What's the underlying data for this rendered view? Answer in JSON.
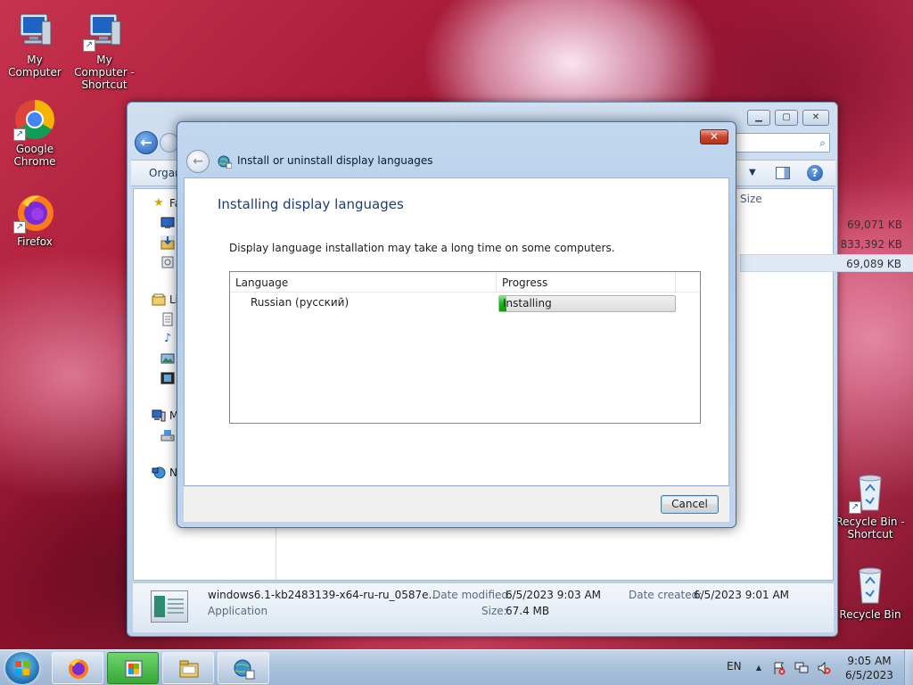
{
  "desktop": {
    "icons": [
      {
        "label": "My Computer"
      },
      {
        "label": "My Computer - Shortcut"
      },
      {
        "label": "Google Chrome"
      },
      {
        "label": "Firefox"
      },
      {
        "label": "Recycle Bin - Shortcut"
      },
      {
        "label": "Recycle Bin"
      }
    ],
    "shortcut_arrow": "↗"
  },
  "explorer": {
    "organize_label": "Organ",
    "search_icon": "⌕",
    "minimize_glyph": "▁",
    "maximize_glyph": "▢",
    "close_glyph": "✕",
    "back_glyph": "←",
    "view_dropdown_glyph": "▼",
    "help_glyph": "?",
    "nav_pane": {
      "favorites_label": "Fa",
      "libraries_label": "Li",
      "computer_label": "M",
      "network_label": "N"
    },
    "size_column_label": "Size",
    "sizes": [
      "69,071 KB",
      "833,392 KB",
      "69,089 KB"
    ],
    "details": {
      "file_name": "windows6.1-kb2483139-x64-ru-ru_0587e...",
      "file_type": "Application",
      "date_modified_label": "Date modified:",
      "date_modified_value": "6/5/2023 9:03 AM",
      "size_label": "Size:",
      "size_value": "67.4 MB",
      "date_created_label": "Date created:",
      "date_created_value": "6/5/2023 9:01 AM"
    }
  },
  "dialog": {
    "title": "Install or uninstall display languages",
    "close_glyph": "✕",
    "back_glyph": "←",
    "heading": "Installing display languages",
    "description": "Display language installation may take a long time on some computers.",
    "table": {
      "col_language": "Language",
      "col_progress": "Progress",
      "rows": [
        {
          "language": "Russian (русский)",
          "status": "Installing",
          "progress_percent": 4
        }
      ]
    },
    "cancel_label": "Cancel"
  },
  "taskbar": {
    "language": "EN",
    "time": "9:05 AM",
    "date": "6/5/2023",
    "tray_up_glyph": "▲"
  },
  "colors": {
    "progress_fill": "#1fb31f",
    "close_button": "#c7432a",
    "dialog_heading": "#1e3c6e"
  }
}
